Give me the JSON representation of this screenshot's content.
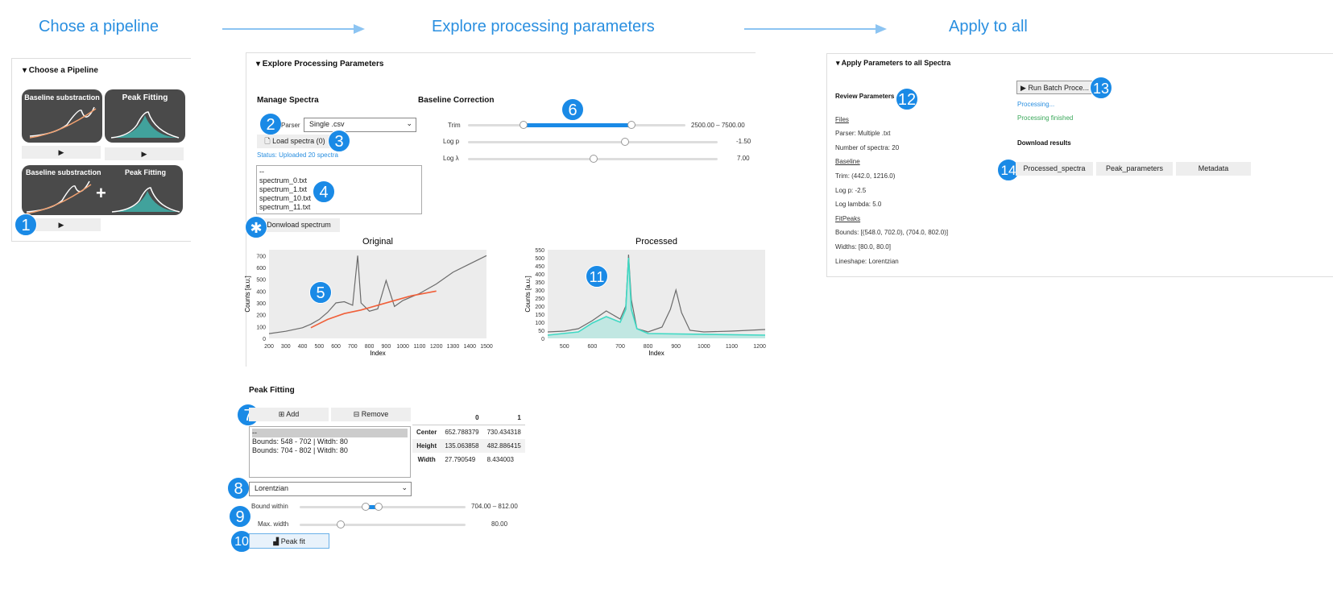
{
  "steps": {
    "pipeline": "Chose a pipeline",
    "explore": "Explore processing parameters",
    "apply": "Apply to all"
  },
  "choose": {
    "title": "▾ Choose a Pipeline",
    "card1": "Baseline substraction",
    "card2": "Peak Fitting",
    "card3a": "Baseline substraction",
    "card3b": "Peak Fitting",
    "plus": "+",
    "play": "▶"
  },
  "explore": {
    "title": "▾ Explore Processing Parameters",
    "manage": "Manage Spectra",
    "parser_label": "Parser",
    "parser_value": "Single .csv",
    "load": "Load spectra (0)",
    "status": "Status: Uploaded 20 spectra",
    "files": [
      "--",
      "spectrum_0.txt",
      "spectrum_1.txt",
      "spectrum_10.txt",
      "spectrum_11.txt"
    ],
    "download": "Donwload spectrum",
    "baseline": "Baseline Correction",
    "trim_label": "Trim",
    "trim_value": "2500.00 – 7500.00",
    "logp_label": "Log p",
    "logp_value": "-1.50",
    "logl_label": "Log λ",
    "logl_value": "7.00",
    "peak_title": "Peak Fitting",
    "add": "Add",
    "remove": "Remove",
    "bounds": [
      "--",
      "Bounds: 548 - 702 | Witdh: 80",
      "Bounds: 704 - 802 | Witdh: 80"
    ],
    "lineshape": "Lorentzian",
    "bound_label": "Bound within",
    "bound_value": "704.00 – 812.00",
    "width_label": "Max. width",
    "width_value": "80.00",
    "peakfit": "Peak fit",
    "table": {
      "cols": [
        "0",
        "1"
      ],
      "rows": [
        {
          "name": "Center",
          "v": [
            "652.788379",
            "730.434318"
          ]
        },
        {
          "name": "Height",
          "v": [
            "135.063858",
            "482.886415"
          ]
        },
        {
          "name": "Width",
          "v": [
            "27.790549",
            "8.434003"
          ]
        }
      ]
    }
  },
  "apply": {
    "title": "▾ Apply Parameters to all Spectra",
    "review": "Review Parameters",
    "files": "Files",
    "parser": "Parser: Multiple .txt",
    "nspec": "Number of spectra: 20",
    "baseline": "Baseline",
    "trim": "Trim: (442.0, 1216.0)",
    "logp": "Log p: -2.5",
    "loglambda": "Log lambda: 5.0",
    "fitpeaks": "FitPeaks",
    "bounds": "Bounds: [(548.0, 702.0), (704.0, 802.0)]",
    "widths": "Widths: [80.0, 80.0]",
    "lineshape": "Lineshape: Lorentzian",
    "run": "▶ Run Batch Proce...",
    "processing": "Processing...",
    "finished": "Processing finished",
    "download": "Download results",
    "b1": "Processed_spectra",
    "b2": "Peak_parameters",
    "b3": "Metadata"
  },
  "badges": [
    "1",
    "2",
    "3",
    "4",
    "5",
    "6",
    "7",
    "8",
    "9",
    "10",
    "11",
    "12",
    "13",
    "14",
    "✱"
  ],
  "colors": {
    "accent": "#1a8ae6",
    "baseline": "#f0603a",
    "fit": "#3fd9c4",
    "spectrum": "#6b6b6b"
  },
  "chart_data": [
    {
      "type": "line",
      "title": "Original",
      "xlabel": "Index",
      "ylabel": "Counts [a.u.]",
      "xlim": [
        200,
        1500
      ],
      "ylim": [
        0,
        750
      ],
      "xticks": [
        "200",
        "300",
        "400",
        "500",
        "600",
        "700",
        "800",
        "900",
        "1000",
        "1100",
        "1200",
        "1300",
        "1400",
        "1500"
      ],
      "yticks": [
        "0",
        "100",
        "200",
        "300",
        "400",
        "500",
        "600",
        "700"
      ],
      "series": [
        {
          "x": [
            200,
            300,
            400,
            450,
            500,
            550,
            600,
            650,
            700,
            730,
            750,
            800,
            850,
            900,
            950,
            1000,
            1100,
            1200,
            1300,
            1400,
            1500
          ],
          "y": [
            40,
            60,
            90,
            120,
            160,
            220,
            300,
            310,
            280,
            700,
            300,
            230,
            250,
            490,
            270,
            320,
            380,
            460,
            560,
            630,
            700
          ]
        },
        {
          "x": [
            450,
            550,
            650,
            750,
            850,
            950,
            1050,
            1200
          ],
          "y": [
            90,
            160,
            210,
            240,
            280,
            320,
            360,
            400
          ]
        }
      ]
    },
    {
      "type": "line",
      "title": "Processed",
      "xlabel": "Index",
      "ylabel": "Counts [a.u.]",
      "xlim": [
        440,
        1220
      ],
      "ylim": [
        0,
        550
      ],
      "xticks": [
        "500",
        "600",
        "700",
        "800",
        "900",
        "1000",
        "1100",
        "1200"
      ],
      "yticks": [
        "0",
        "50",
        "100",
        "150",
        "200",
        "250",
        "300",
        "350",
        "400",
        "450",
        "500",
        "550"
      ],
      "series": [
        {
          "x": [
            440,
            500,
            550,
            600,
            650,
            700,
            720,
            730,
            740,
            760,
            800,
            850,
            880,
            900,
            920,
            950,
            1000,
            1100,
            1220
          ],
          "y": [
            40,
            45,
            60,
            110,
            170,
            120,
            200,
            520,
            240,
            60,
            40,
            70,
            180,
            300,
            160,
            50,
            40,
            45,
            55
          ]
        },
        {
          "x": [
            440,
            550,
            600,
            650,
            700,
            720,
            730,
            740,
            760,
            800,
            1220
          ],
          "y": [
            20,
            40,
            95,
            135,
            100,
            180,
            500,
            180,
            60,
            30,
            20
          ]
        }
      ]
    }
  ]
}
